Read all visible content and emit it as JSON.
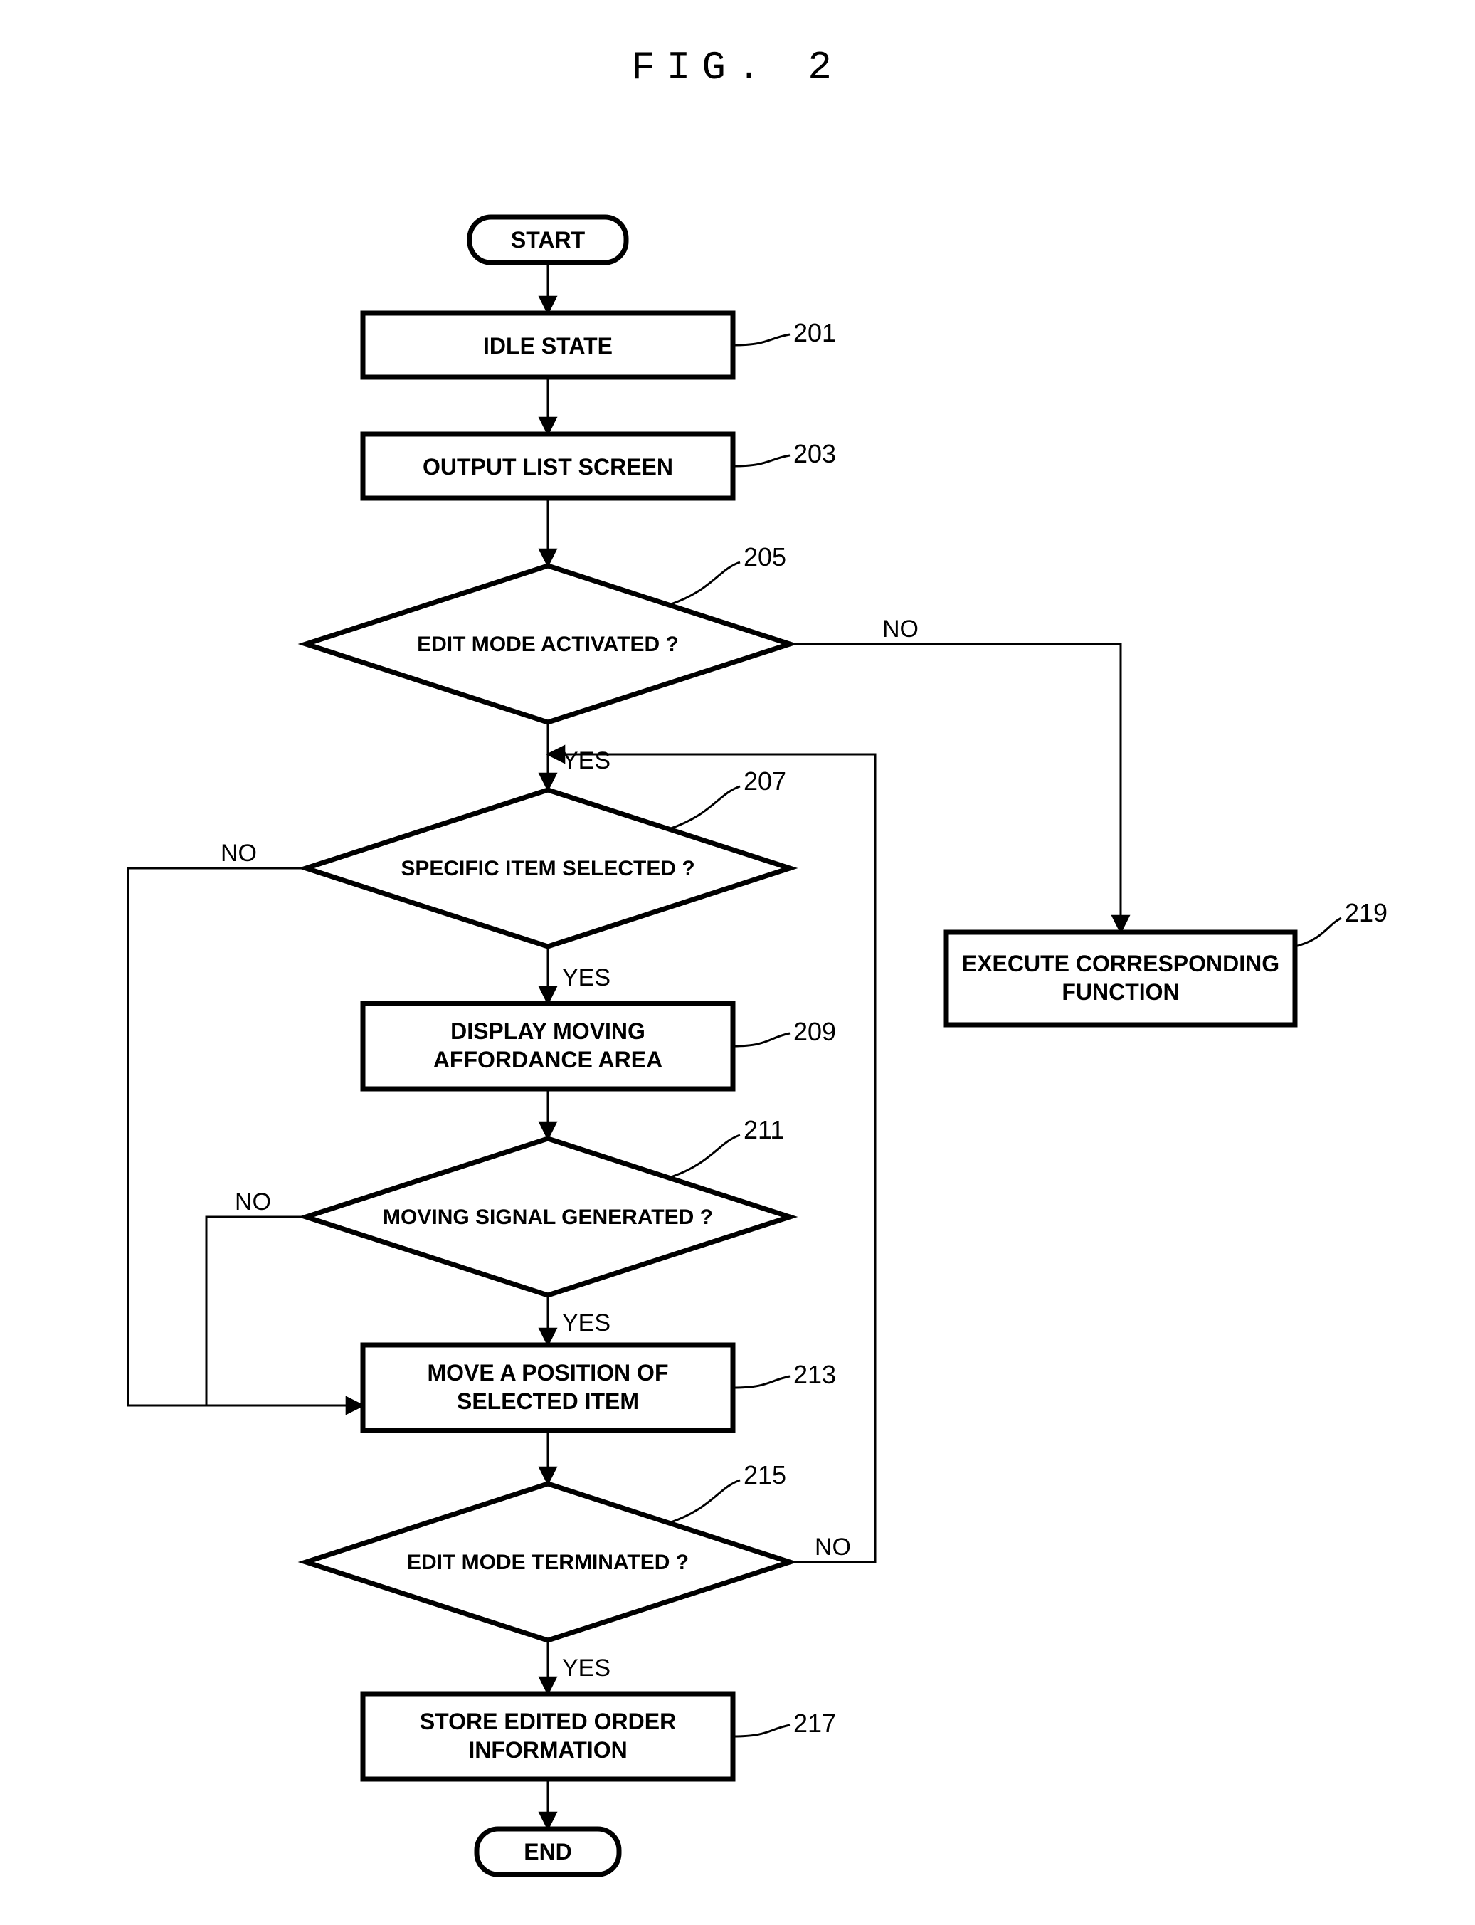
{
  "figure_title": "FIG. 2",
  "nodes": {
    "start": "START",
    "end": "END",
    "n201": "IDLE STATE",
    "n203": "OUTPUT LIST SCREEN",
    "n205": "EDIT MODE ACTIVATED ?",
    "n207": "SPECIFIC ITEM SELECTED ?",
    "n209_l1": "DISPLAY MOVING",
    "n209_l2": "AFFORDANCE AREA",
    "n211": "MOVING SIGNAL GENERATED ?",
    "n213_l1": "MOVE A POSITION OF",
    "n213_l2": "SELECTED ITEM",
    "n215": "EDIT MODE TERMINATED ?",
    "n217_l1": "STORE EDITED ORDER",
    "n217_l2": "INFORMATION",
    "n219_l1": "EXECUTE CORRESPONDING",
    "n219_l2": "FUNCTION"
  },
  "refs": {
    "n201": "201",
    "n203": "203",
    "n205": "205",
    "n207": "207",
    "n209": "209",
    "n211": "211",
    "n213": "213",
    "n215": "215",
    "n217": "217",
    "n219": "219"
  },
  "edges": {
    "yes": "YES",
    "no": "NO"
  }
}
